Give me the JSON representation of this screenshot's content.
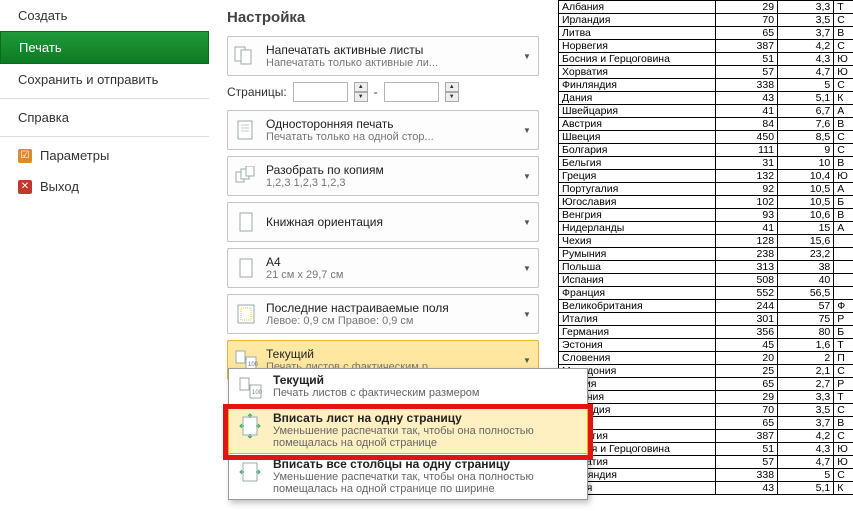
{
  "sidebar": {
    "items": [
      {
        "label": "Создать"
      },
      {
        "label": "Печать"
      },
      {
        "label": "Сохранить и отправить"
      },
      {
        "label": "Справка"
      },
      {
        "label": "Параметры"
      },
      {
        "label": "Выход"
      }
    ]
  },
  "settings": {
    "title": "Настройка",
    "print_active": {
      "title": "Напечатать активные листы",
      "sub": "Напечатать только активные ли..."
    },
    "pages_label": "Страницы:",
    "pages_dash": "-",
    "onesided": {
      "title": "Односторонняя печать",
      "sub": "Печатать только на одной стор..."
    },
    "collate": {
      "title": "Разобрать по копиям",
      "sub": "1,2,3   1,2,3   1,2,3"
    },
    "orientation": {
      "title": "Книжная ориентация"
    },
    "paper": {
      "title": "A4",
      "sub": "21 см x 29,7 см"
    },
    "margins": {
      "title": "Последние настраиваемые поля",
      "sub": "Левое:  0,9 см    Правое:  0,9 см"
    },
    "scaling": {
      "title": "Текущий",
      "sub": "Печать листов с фактическим р..."
    }
  },
  "dropdown": {
    "opt1": {
      "title": "Текущий",
      "sub": "Печать листов с фактическим размером"
    },
    "opt2": {
      "title": "Вписать лист на одну страницу",
      "sub": "Уменьшение распечатки так, чтобы она полностью помещалась на одной странице"
    },
    "opt3": {
      "title": "Вписать все столбцы на одну страницу",
      "sub": "Уменьшение распечатки так, чтобы она полностью помещалась на одной странице по ширине"
    }
  },
  "table": [
    [
      "Албания",
      "29",
      "3,3",
      "Т"
    ],
    [
      "Ирландия",
      "70",
      "3,5",
      "С"
    ],
    [
      "Литва",
      "65",
      "3,7",
      "В"
    ],
    [
      "Норвегия",
      "387",
      "4,2",
      "С"
    ],
    [
      "Босния и Герцоговина",
      "51",
      "4,3",
      "Ю"
    ],
    [
      "Хорватия",
      "57",
      "4,7",
      "Ю"
    ],
    [
      "Финляндия",
      "338",
      "5",
      "С"
    ],
    [
      "Дания",
      "43",
      "5,1",
      "К"
    ],
    [
      "Швейцария",
      "41",
      "6,7",
      "А"
    ],
    [
      "Австрия",
      "84",
      "7,6",
      "В"
    ],
    [
      "Швеция",
      "450",
      "8,5",
      "С"
    ],
    [
      "Болгария",
      "111",
      "9",
      "С"
    ],
    [
      "Бельгия",
      "31",
      "10",
      "В"
    ],
    [
      "Греция",
      "132",
      "10,4",
      "Ю"
    ],
    [
      "Португалия",
      "92",
      "10,5",
      "А"
    ],
    [
      "Югославия",
      "102",
      "10,5",
      "Б"
    ],
    [
      "Венгрия",
      "93",
      "10,6",
      "В"
    ],
    [
      "Нидерланды",
      "41",
      "15",
      "А"
    ],
    [
      "Чехия",
      "128",
      "15,6",
      ""
    ],
    [
      "Румыния",
      "238",
      "23,2",
      ""
    ],
    [
      "Польша",
      "313",
      "38",
      ""
    ],
    [
      "Испания",
      "508",
      "40",
      ""
    ],
    [
      "Франция",
      "552",
      "56,5",
      ""
    ],
    [
      "Великобритания",
      "244",
      "57",
      "Ф"
    ],
    [
      "Италия",
      "301",
      "75",
      "Р"
    ],
    [
      "Германия",
      "356",
      "80",
      "Б"
    ],
    [
      "Эстония",
      "45",
      "1,6",
      "Т"
    ],
    [
      "Словения",
      "20",
      "2",
      "П"
    ],
    [
      "Македония",
      "25",
      "2,1",
      "С"
    ],
    [
      "Латвия",
      "65",
      "2,7",
      "Р"
    ],
    [
      "Албания",
      "29",
      "3,3",
      "Т"
    ],
    [
      "Ирландия",
      "70",
      "3,5",
      "С"
    ],
    [
      "Литва",
      "65",
      "3,7",
      "В"
    ],
    [
      "Норвегия",
      "387",
      "4,2",
      "С"
    ],
    [
      "Босния и Герцоговина",
      "51",
      "4,3",
      "Ю"
    ],
    [
      "Хорватия",
      "57",
      "4,7",
      "Ю"
    ],
    [
      "Финляндия",
      "338",
      "5",
      "С"
    ],
    [
      "Дания",
      "43",
      "5,1",
      "К"
    ]
  ]
}
